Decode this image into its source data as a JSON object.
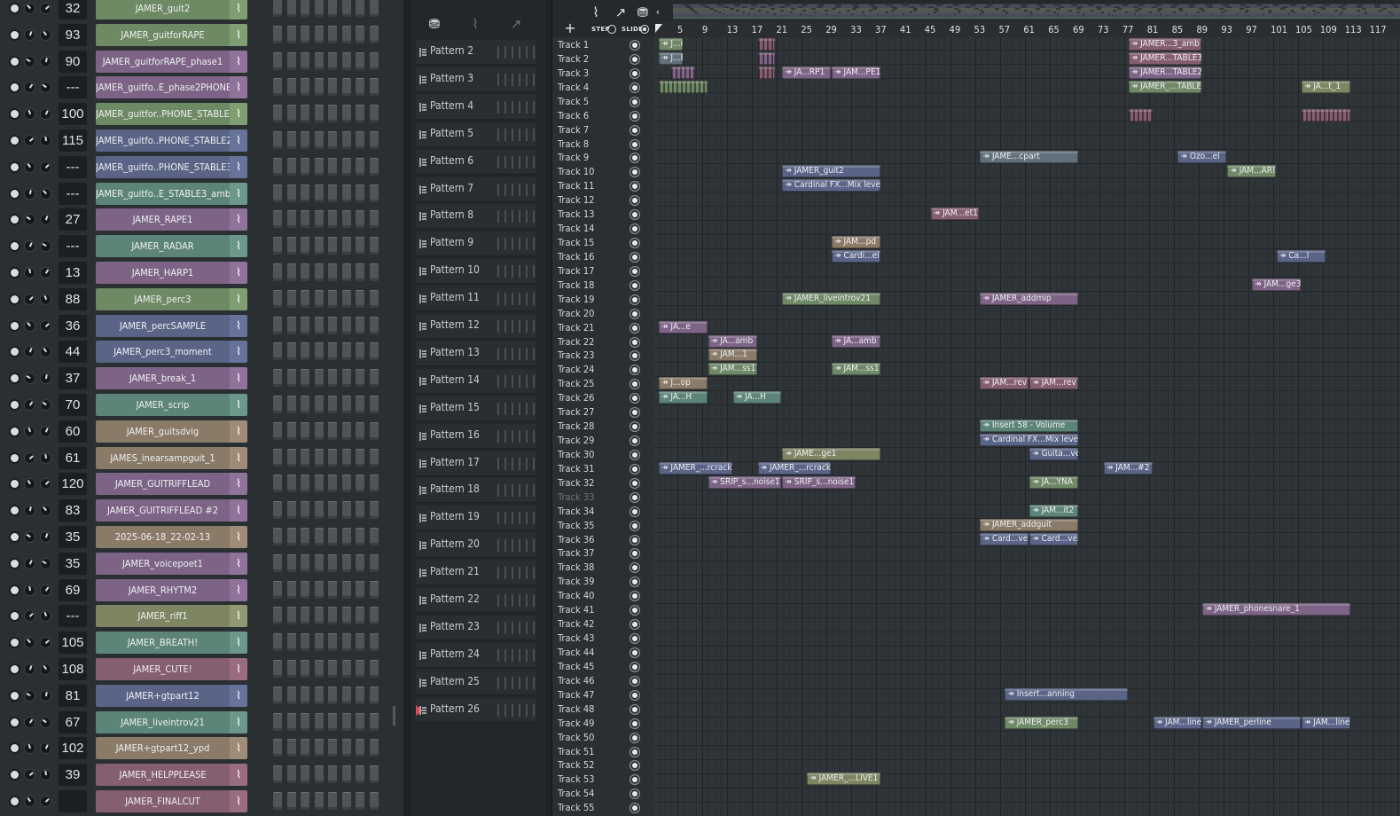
{
  "channel_rack": {
    "channels": [
      {
        "number": "32",
        "name": "JAMER_guit2",
        "color": "#6e8a64"
      },
      {
        "number": "93",
        "name": "JAMER_guitforRAPE",
        "color": "#6e8a64"
      },
      {
        "number": "90",
        "name": "JAMER_guitforRAPE_phase1",
        "color": "#7d6486"
      },
      {
        "number": "---",
        "name": "JAMER_guitfo..E_phase2PHONE",
        "color": "#7d6486"
      },
      {
        "number": "100",
        "name": "JAMER_guitfor..PHONE_STABLE",
        "color": "#6e8a64"
      },
      {
        "number": "115",
        "name": "JAMER_guitfo..PHONE_STABLE2",
        "color": "#5a6487"
      },
      {
        "number": "---",
        "name": "JAMER_guitfo..PHONE_STABLE3",
        "color": "#5a6487"
      },
      {
        "number": "---",
        "name": "JAMER_guitfo..E_STABLE3_amb",
        "color": "#5d8478"
      },
      {
        "number": "27",
        "name": "JAMER_RAPE1",
        "color": "#7d6486"
      },
      {
        "number": "---",
        "name": "JAMER_RADAR",
        "color": "#5d8478"
      },
      {
        "number": "13",
        "name": "JAMER_HARP1",
        "color": "#7d6486"
      },
      {
        "number": "88",
        "name": "JAMER_perc3",
        "color": "#6e8a64"
      },
      {
        "number": "36",
        "name": "JAMER_percSAMPLE",
        "color": "#5a6487"
      },
      {
        "number": "44",
        "name": "JAMER_perc3_moment",
        "color": "#5a6487"
      },
      {
        "number": "37",
        "name": "JAMER_break_1",
        "color": "#7d6486"
      },
      {
        "number": "70",
        "name": "JAMER_scrip",
        "color": "#5d8478"
      },
      {
        "number": "60",
        "name": "JAMER_guitsdvig",
        "color": "#8a7a68"
      },
      {
        "number": "61",
        "name": "JAMES_inearsampguit_1",
        "color": "#8a7a68"
      },
      {
        "number": "120",
        "name": "JAMER_GUITRIFFLEAD",
        "color": "#7d6486"
      },
      {
        "number": "83",
        "name": "JAMER_GUITRIFFLEAD #2",
        "color": "#7d6486"
      },
      {
        "number": "35",
        "name": "2025-06-18_22-02-13",
        "color": "#8a7a68"
      },
      {
        "number": "35",
        "name": "JAMER_voicepoet1",
        "color": "#7d6486"
      },
      {
        "number": "69",
        "name": "JAMER_RHYTM2",
        "color": "#7d6486"
      },
      {
        "number": "---",
        "name": "JAMER_riff1",
        "color": "#7d8563"
      },
      {
        "number": "105",
        "name": "JAMER_BREATH!",
        "color": "#5d8478"
      },
      {
        "number": "108",
        "name": "JAMER_CUTE!",
        "color": "#855e71"
      },
      {
        "number": "81",
        "name": "JAMER+gtpart12",
        "color": "#5a6487"
      },
      {
        "number": "67",
        "name": "JAMER_liveintrov21",
        "color": "#5d8478"
      },
      {
        "number": "102",
        "name": "JAMER+gtpart12_ypd",
        "color": "#8a7a68"
      },
      {
        "number": "39",
        "name": "JAMER_HELPPLEASE",
        "color": "#855e71"
      },
      {
        "number": "",
        "name": "JAMER_FINALCUT",
        "color": "#855e71"
      }
    ]
  },
  "pattern_picker": {
    "tools": [
      "piano-roll-icon",
      "audio-wave-icon",
      "automation-icon"
    ],
    "patterns": [
      "Pattern 2",
      "Pattern 3",
      "Pattern 4",
      "Pattern 5",
      "Pattern 6",
      "Pattern 7",
      "Pattern 8",
      "Pattern 9",
      "Pattern 10",
      "Pattern 11",
      "Pattern 12",
      "Pattern 13",
      "Pattern 14",
      "Pattern 15",
      "Pattern 16",
      "Pattern 17",
      "Pattern 18",
      "Pattern 19",
      "Pattern 20",
      "Pattern 21",
      "Pattern 22",
      "Pattern 23",
      "Pattern 24",
      "Pattern 25",
      "Pattern 26"
    ],
    "selected": "Pattern 26",
    "selected_color": "#e2455a"
  },
  "playlist": {
    "toolbar": {
      "add": "+",
      "step_label": "STEP",
      "slide_label": "SLIDE"
    },
    "bar_numbers": [
      "5",
      "9",
      "13",
      "17",
      "21",
      "25",
      "29",
      "33",
      "37",
      "41",
      "45",
      "49",
      "53",
      "57",
      "61",
      "65",
      "69",
      "73",
      "77",
      "81",
      "85",
      "89",
      "93",
      "97",
      "101",
      "105",
      "109",
      "113",
      "117"
    ],
    "tracks": [
      "Track 1",
      "Track 2",
      "Track 3",
      "Track 4",
      "Track 5",
      "Track 6",
      "Track 7",
      "Track 8",
      "Track 9",
      "Track 10",
      "Track 11",
      "Track 12",
      "Track 13",
      "Track 14",
      "Track 15",
      "Track 16",
      "Track 17",
      "Track 18",
      "Track 19",
      "Track 20",
      "Track 21",
      "Track 22",
      "Track 23",
      "Track 24",
      "Track 25",
      "Track 26",
      "Track 27",
      "Track 28",
      "Track 29",
      "Track 30",
      "Track 31",
      "Track 32",
      "Track 33",
      "Track 34",
      "Track 35",
      "Track 36",
      "Track 37",
      "Track 38",
      "Track 39",
      "Track 40",
      "Track 41",
      "Track 42",
      "Track 43",
      "Track 44",
      "Track 45",
      "Track 46",
      "Track 47",
      "Track 48",
      "Track 49",
      "Track 50",
      "Track 51",
      "Track 52",
      "Track 53",
      "Track 54",
      "Track 55"
    ],
    "dim_tracks": [
      "Track 33"
    ],
    "clips": [
      {
        "track": 1,
        "start": 1,
        "len": 4,
        "label": "J...mb",
        "color": "c-green"
      },
      {
        "track": 1,
        "start": 17,
        "len": 3,
        "label": "",
        "color": "c-mauve"
      },
      {
        "track": 1,
        "start": 77,
        "len": 12,
        "label": "JAMER...3_amb",
        "color": "c-mauve"
      },
      {
        "track": 2,
        "start": 1,
        "len": 4,
        "label": "J...E3",
        "color": "c-slate"
      },
      {
        "track": 2,
        "start": 17,
        "len": 3,
        "label": "",
        "color": "c-purple"
      },
      {
        "track": 2,
        "start": 77,
        "len": 12,
        "label": "JAMER...TABLE3",
        "color": "c-mauve"
      },
      {
        "track": 3,
        "start": 3,
        "len": 4,
        "label": "",
        "color": "c-purple"
      },
      {
        "track": 3,
        "start": 17,
        "len": 3,
        "label": "",
        "color": "c-mauve"
      },
      {
        "track": 3,
        "start": 21,
        "len": 8,
        "label": "JA...RP1",
        "color": "c-purple"
      },
      {
        "track": 3,
        "start": 29,
        "len": 8,
        "label": "JAM...PE1",
        "color": "c-purple"
      },
      {
        "track": 3,
        "start": 77,
        "len": 12,
        "label": "JAMER...TABLE2",
        "color": "c-purple"
      },
      {
        "track": 4,
        "start": 1,
        "len": 8,
        "label": "",
        "color": "c-green"
      },
      {
        "track": 4,
        "start": 77,
        "len": 12,
        "label": "JAMER_...TABLE",
        "color": "c-green"
      },
      {
        "track": 4,
        "start": 105,
        "len": 8,
        "label": "JA...t_1",
        "color": "c-olive"
      },
      {
        "track": 6,
        "start": 77,
        "len": 4,
        "label": "",
        "color": "c-mauve"
      },
      {
        "track": 6,
        "start": 105,
        "len": 8,
        "label": "",
        "color": "c-mauve"
      },
      {
        "track": 9,
        "start": 53,
        "len": 16,
        "label": "JAME...cpart",
        "color": "c-slate"
      },
      {
        "track": 9,
        "start": 85,
        "len": 8,
        "label": "Ozo...el",
        "color": "c-blue"
      },
      {
        "track": 10,
        "start": 21,
        "len": 16,
        "label": "JAMER_guit2",
        "color": "c-blue"
      },
      {
        "track": 10,
        "start": 93,
        "len": 8,
        "label": "JAM...AR!",
        "color": "c-green"
      },
      {
        "track": 11,
        "start": 21,
        "len": 16,
        "label": "Cardinal FX...Mix level",
        "color": "c-blue"
      },
      {
        "track": 13,
        "start": 45,
        "len": 8,
        "label": "JAM...et1",
        "color": "c-mauve"
      },
      {
        "track": 15,
        "start": 29,
        "len": 8,
        "label": "JAM...pd",
        "color": "c-tan"
      },
      {
        "track": 16,
        "start": 29,
        "len": 8,
        "label": "Cardi...el",
        "color": "c-blue"
      },
      {
        "track": 16,
        "start": 101,
        "len": 8,
        "label": "Ca...l",
        "color": "c-blue"
      },
      {
        "track": 18,
        "start": 97,
        "len": 8,
        "label": "JAM...ge3",
        "color": "c-purple"
      },
      {
        "track": 19,
        "start": 21,
        "len": 16,
        "label": "JAMER_liveintrov21",
        "color": "c-green"
      },
      {
        "track": 19,
        "start": 53,
        "len": 16,
        "label": "JAMER_addmip",
        "color": "c-purple"
      },
      {
        "track": 21,
        "start": 1,
        "len": 8,
        "label": "JA...e",
        "color": "c-purple"
      },
      {
        "track": 22,
        "start": 9,
        "len": 8,
        "label": "JA...amb",
        "color": "c-purple"
      },
      {
        "track": 22,
        "start": 29,
        "len": 8,
        "label": "JA...amb",
        "color": "c-purple"
      },
      {
        "track": 23,
        "start": 9,
        "len": 8,
        "label": "JAM...1",
        "color": "c-tan"
      },
      {
        "track": 24,
        "start": 9,
        "len": 8,
        "label": "JAM...ss1",
        "color": "c-green"
      },
      {
        "track": 24,
        "start": 29,
        "len": 8,
        "label": "JAM...ss1",
        "color": "c-green"
      },
      {
        "track": 25,
        "start": 1,
        "len": 8,
        "label": "J...op",
        "color": "c-tan"
      },
      {
        "track": 25,
        "start": 53,
        "len": 8,
        "label": "JAM...rev",
        "color": "c-mauve"
      },
      {
        "track": 25,
        "start": 61,
        "len": 8,
        "label": "JAM...rev",
        "color": "c-mauve"
      },
      {
        "track": 26,
        "start": 1,
        "len": 8,
        "label": "JA...H",
        "color": "c-teal"
      },
      {
        "track": 26,
        "start": 13,
        "len": 8,
        "label": "JA...H",
        "color": "c-teal"
      },
      {
        "track": 28,
        "start": 53,
        "len": 16,
        "label": "Insert 58 - Volume",
        "color": "c-teal"
      },
      {
        "track": 29,
        "start": 53,
        "len": 16,
        "label": "Cardinal FX...Mix level",
        "color": "c-blue"
      },
      {
        "track": 30,
        "start": 21,
        "len": 16,
        "label": "JAME...ge1",
        "color": "c-olive"
      },
      {
        "track": 30,
        "start": 61,
        "len": 8,
        "label": "Guita...vel",
        "color": "c-blue"
      },
      {
        "track": 31,
        "start": 1,
        "len": 12,
        "label": "JAMER_...rcrack",
        "color": "c-blue"
      },
      {
        "track": 31,
        "start": 17,
        "len": 12,
        "label": "JAMER_...rcrack",
        "color": "c-blue"
      },
      {
        "track": 31,
        "start": 73,
        "len": 8,
        "label": "JAM...#2",
        "color": "c-blue"
      },
      {
        "track": 32,
        "start": 9,
        "len": 12,
        "label": "SRIP_s...noise1",
        "color": "c-purple"
      },
      {
        "track": 32,
        "start": 21,
        "len": 12,
        "label": "SRIP_s...noise1",
        "color": "c-purple"
      },
      {
        "track": 32,
        "start": 61,
        "len": 8,
        "label": "JA...YNA",
        "color": "c-green"
      },
      {
        "track": 34,
        "start": 61,
        "len": 8,
        "label": "JAM...it2",
        "color": "c-teal"
      },
      {
        "track": 35,
        "start": 53,
        "len": 16,
        "label": "JAMER_addguit",
        "color": "c-tan"
      },
      {
        "track": 36,
        "start": 53,
        "len": 8,
        "label": "Card...vel",
        "color": "c-blue"
      },
      {
        "track": 36,
        "start": 61,
        "len": 8,
        "label": "Card...vel",
        "color": "c-blue"
      },
      {
        "track": 41,
        "start": 89,
        "len": 24,
        "label": "JAMER_phonesnare_1",
        "color": "c-purple"
      },
      {
        "track": 47,
        "start": 57,
        "len": 20,
        "label": "Insert...anning",
        "color": "c-blue"
      },
      {
        "track": 49,
        "start": 57,
        "len": 12,
        "label": "JAMER_perc3",
        "color": "c-green"
      },
      {
        "track": 49,
        "start": 81,
        "len": 8,
        "label": "JAM...line",
        "color": "c-blue"
      },
      {
        "track": 49,
        "start": 89,
        "len": 16,
        "label": "JAMER_perline",
        "color": "c-blue"
      },
      {
        "track": 49,
        "start": 105,
        "len": 8,
        "label": "JAM...line",
        "color": "c-blue"
      },
      {
        "track": 53,
        "start": 25,
        "len": 12,
        "label": "JAMER_...LIVE1",
        "color": "c-olive"
      }
    ]
  },
  "colors": {
    "accent": "#e2455a",
    "background": "#2b3034"
  }
}
